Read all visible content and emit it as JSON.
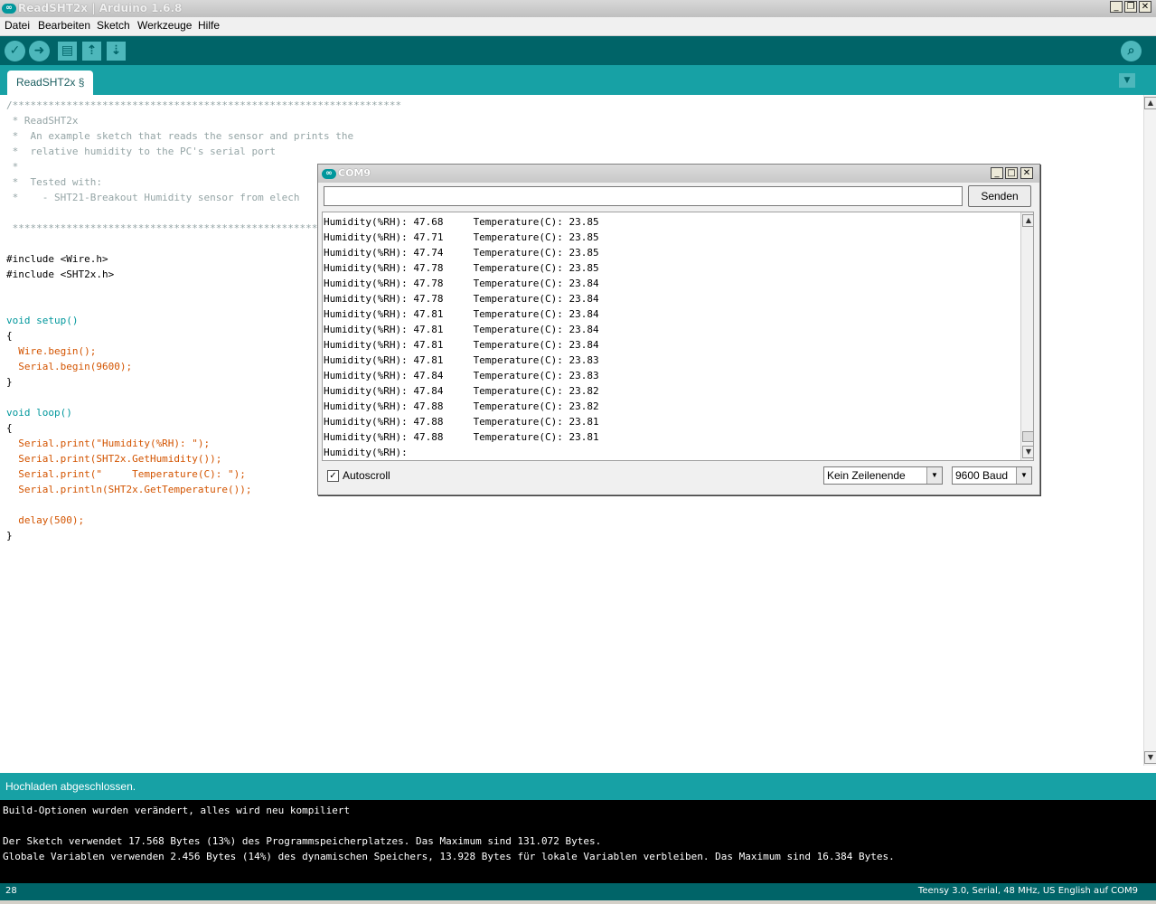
{
  "window": {
    "title": "ReadSHT2x | Arduino 1.6.8",
    "app_icon": "arduino-infinity-icon"
  },
  "menu": [
    "Datei",
    "Bearbeiten",
    "Sketch",
    "Werkzeuge",
    "Hilfe"
  ],
  "toolbar": {
    "buttons": [
      "verify-icon",
      "upload-icon",
      "new-icon",
      "open-icon",
      "save-icon"
    ],
    "right": "serial-monitor-icon"
  },
  "tab": {
    "label": "ReadSHT2x §"
  },
  "code": [
    "/*****************************************************************",
    " * ReadSHT2x",
    " *  An example sketch that reads the sensor and prints the",
    " *  relative humidity to the PC's serial port",
    " *",
    " *  Tested with:",
    " *    - SHT21-Breakout Humidity sensor from elech",
    " ",
    " *****************************************************************",
    " ",
    "#include <Wire.h>",
    "#include <SHT2x.h>",
    " ",
    " ",
    "void setup()",
    "{",
    "  Wire.begin();",
    "  Serial.begin(9600);",
    "}",
    " ",
    "void loop()",
    "{",
    "  Serial.print(\"Humidity(%RH): \");",
    "  Serial.print(SHT2x.GetHumidity());",
    "  Serial.print(\"     Temperature(C): \");",
    "  Serial.println(SHT2x.GetTemperature());",
    " ",
    "  delay(500);",
    "}"
  ],
  "status": {
    "message": "Hochladen abgeschlossen."
  },
  "console": [
    "Build-Optionen wurden verändert, alles wird neu kompiliert",
    "",
    "Der Sketch verwendet 17.568 Bytes (13%) des Programmspeicherplatzes. Das Maximum sind 131.072 Bytes.",
    "Globale Variablen verwenden 2.456 Bytes (14%) des dynamischen Speichers, 13.928 Bytes für lokale Variablen verbleiben. Das Maximum sind 16.384 Bytes."
  ],
  "bottom": {
    "line": "28",
    "board": "Teensy 3.0, Serial, 48 MHz, US English auf COM9"
  },
  "serial": {
    "title": "COM9",
    "input_value": "",
    "send_label": "Senden",
    "output": [
      "Humidity(%RH): 47.68     Temperature(C): 23.85",
      "Humidity(%RH): 47.71     Temperature(C): 23.85",
      "Humidity(%RH): 47.74     Temperature(C): 23.85",
      "Humidity(%RH): 47.78     Temperature(C): 23.85",
      "Humidity(%RH): 47.78     Temperature(C): 23.84",
      "Humidity(%RH): 47.78     Temperature(C): 23.84",
      "Humidity(%RH): 47.81     Temperature(C): 23.84",
      "Humidity(%RH): 47.81     Temperature(C): 23.84",
      "Humidity(%RH): 47.81     Temperature(C): 23.84",
      "Humidity(%RH): 47.81     Temperature(C): 23.83",
      "Humidity(%RH): 47.84     Temperature(C): 23.83",
      "Humidity(%RH): 47.84     Temperature(C): 23.82",
      "Humidity(%RH): 47.88     Temperature(C): 23.82",
      "Humidity(%RH): 47.88     Temperature(C): 23.81",
      "Humidity(%RH): 47.88     Temperature(C): 23.81",
      "Humidity(%RH):"
    ],
    "autoscroll_label": "Autoscroll",
    "autoscroll_checked": true,
    "line_ending": "Kein Zeilenende",
    "baud": "9600 Baud"
  },
  "colors": {
    "teal_dark": "#006468",
    "teal": "#17a1a5",
    "console_bg": "#000000"
  }
}
